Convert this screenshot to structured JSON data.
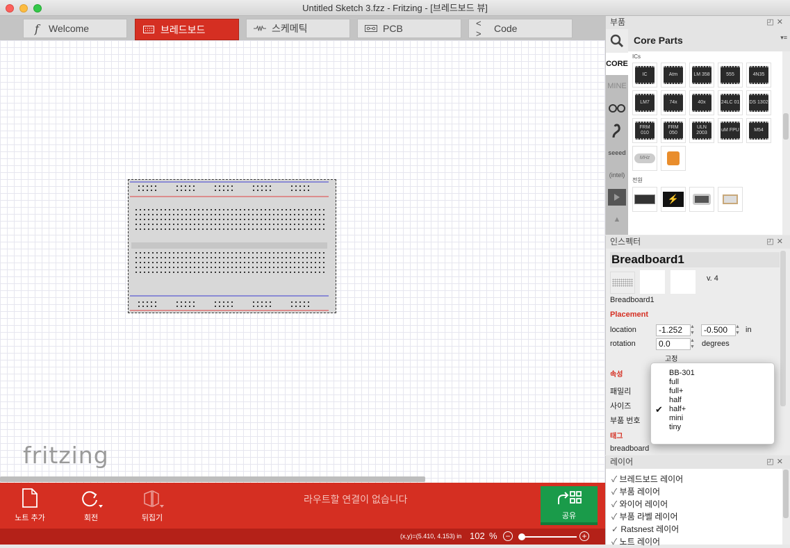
{
  "window": {
    "title": "Untitled Sketch 3.fzz - Fritzing - [브레드보드 뷰]"
  },
  "tabs": [
    {
      "label": "Welcome",
      "icon": "fritzing-f-icon"
    },
    {
      "label": "브레드보드",
      "icon": "breadboard-icon"
    },
    {
      "label": "스케메틱",
      "icon": "resistor-icon"
    },
    {
      "label": "PCB",
      "icon": "pcb-icon"
    },
    {
      "label": "Code",
      "icon": "code-brackets-icon"
    }
  ],
  "canvas": {
    "logo": "fritzing"
  },
  "toolbar": {
    "add_note": "노트 추가",
    "rotate": "회전",
    "flip": "뒤집기",
    "routing_status": "라우트할 연결이 없습니다",
    "share": "공유"
  },
  "status": {
    "coords": "(x,y)=(5.410, 4.153) in",
    "zoom": "102",
    "zoom_unit": "%"
  },
  "parts": {
    "panel_title": "부품",
    "bin_title": "Core Parts",
    "tabs": [
      "CORE",
      "MINE"
    ],
    "ics_label": "ICs",
    "power_label": "전원",
    "ic_rows": [
      [
        "IC",
        "Atm",
        "LM 358",
        "555",
        "4N35"
      ],
      [
        "LM7",
        "74x",
        "40x",
        "24LC 01",
        "DS 1302"
      ],
      [
        "FRM 010",
        "FRM 050",
        "ULN 2003",
        "uM FPU",
        "M54"
      ]
    ],
    "misc": [
      "MHz",
      ""
    ]
  },
  "inspector": {
    "panel_title": "인스펙터",
    "title": "Breadboard1",
    "version": "v. 4",
    "name": "Breadboard1",
    "placement": "Placement",
    "location_label": "location",
    "location_x": "-1.252",
    "location_y": "-0.500",
    "location_unit": "in",
    "rotation_label": "rotation",
    "rotation_value": "0.0",
    "rotation_unit": "degrees",
    "locked": "고정",
    "properties": "속성",
    "family": "패밀리",
    "size": "사이즈",
    "part_number": "부품 번호",
    "tags": "태그",
    "tag_value": "breadboard"
  },
  "size_menu": {
    "options": [
      "BB-301",
      "full",
      "full+",
      "half",
      "half+",
      "mini",
      "tiny"
    ],
    "selected": "half+"
  },
  "layers": {
    "panel_title": "레이어",
    "items": [
      "브레드보드 레이어",
      "부품 레이어",
      "와이어 레이어",
      "부품 라벨 레이어",
      "Ratsnest 레이어",
      "노트 레이어"
    ]
  },
  "colors": {
    "accent": "#d52f22",
    "share": "#1a9b4a"
  }
}
